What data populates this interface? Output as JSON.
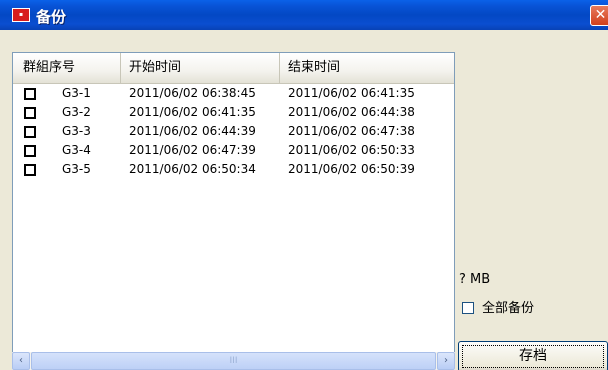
{
  "window": {
    "title": "备份",
    "app_icon": "app-logo-icon",
    "close_icon": "close-icon"
  },
  "list": {
    "columns": [
      "群組序号",
      "开始时间",
      "结束时间"
    ],
    "rows": [
      {
        "checked": false,
        "group": "G3-1",
        "start": "2011/06/02 06:38:45",
        "end": "2011/06/02 06:41:35"
      },
      {
        "checked": false,
        "group": "G3-2",
        "start": "2011/06/02 06:41:35",
        "end": "2011/06/02 06:44:38"
      },
      {
        "checked": false,
        "group": "G3-3",
        "start": "2011/06/02 06:44:39",
        "end": "2011/06/02 06:47:38"
      },
      {
        "checked": false,
        "group": "G3-4",
        "start": "2011/06/02 06:47:39",
        "end": "2011/06/02 06:50:33"
      },
      {
        "checked": false,
        "group": "G3-5",
        "start": "2011/06/02 06:50:34",
        "end": "2011/06/02 06:50:39"
      }
    ]
  },
  "panel": {
    "size_text": "?  MB",
    "backup_all_label": "全部备份",
    "backup_all_checked": false,
    "save_label": "存档"
  },
  "scrollbar": {
    "left_arrow": "‹",
    "right_arrow": "›",
    "grip": "III"
  },
  "colors": {
    "titlebar": "#0348c4",
    "close_button": "#d2401c",
    "list_border": "#7f9db9",
    "window_bg": "#ece9d8"
  }
}
